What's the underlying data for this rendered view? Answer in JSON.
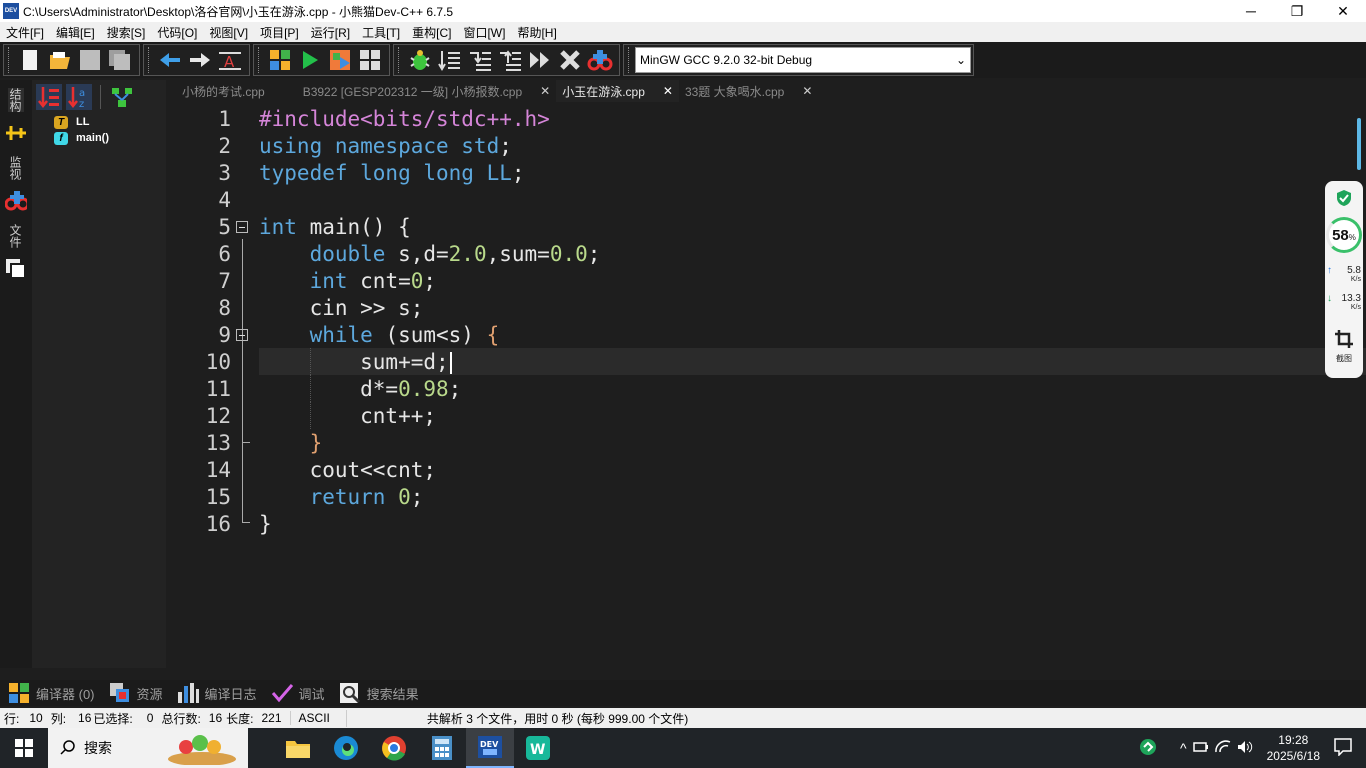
{
  "window": {
    "title": "C:\\Users\\Administrator\\Desktop\\洛谷官网\\小玉在游泳.cpp - 小熊猫Dev-C++ 6.7.5",
    "app_icon": "DEV",
    "controls": {
      "minimize": "─",
      "maximize": "❐",
      "close": "✕"
    }
  },
  "menu": [
    "文件[F]",
    "编辑[E]",
    "搜索[S]",
    "代码[O]",
    "视图[V]",
    "项目[P]",
    "运行[R]",
    "工具[T]",
    "重构[C]",
    "窗口[W]",
    "帮助[H]"
  ],
  "toolbar": {
    "compiler": "MinGW GCC 9.2.0 32-bit Debug",
    "dropdown_arrow": "⌄"
  },
  "left_tabs": {
    "structure": "结构",
    "watch": "监视",
    "files": "文件"
  },
  "class_browser": {
    "items": [
      {
        "badge": "T",
        "label": "LL",
        "badge_color": "#d9a520"
      },
      {
        "badge": "f",
        "label": "main()",
        "badge_color": "#40d8e8"
      }
    ]
  },
  "tabs": [
    {
      "label": "小杨的考试.cpp",
      "active": false
    },
    {
      "label": "B3922 [GESP202312 一级] 小杨报数.cpp",
      "active": false,
      "close": "✕"
    },
    {
      "label": "小玉在游泳.cpp",
      "active": true,
      "close": "✕"
    },
    {
      "label": "33题 大象喝水.cpp",
      "active": false,
      "close": "✕"
    }
  ],
  "code": {
    "line_numbers": [
      "1",
      "2",
      "3",
      "4",
      "5",
      "6",
      "7",
      "8",
      "9",
      "10",
      "11",
      "12",
      "13",
      "14",
      "15",
      "16"
    ],
    "current_line": 10
  },
  "net_widget": {
    "percent": "58",
    "percent_unit": "%",
    "upload": "5.8",
    "upload_unit": "K/s",
    "download": "13.3",
    "download_unit": "K/s",
    "screenshot_label": "截图"
  },
  "bottom_tabs": [
    {
      "label": "编译器 (0)",
      "icon": "compiler-icon"
    },
    {
      "label": "资源",
      "icon": "resources-icon"
    },
    {
      "label": "编译日志",
      "icon": "compile-log-icon"
    },
    {
      "label": "调试",
      "icon": "debug-icon"
    },
    {
      "label": "搜索结果",
      "icon": "search-results-icon"
    }
  ],
  "status": {
    "row_label": "行:",
    "row": "10",
    "col_label": "列:",
    "col": "16",
    "selected_label": "已选择:",
    "selected": "0",
    "total_lines_label": "总行数:",
    "total_lines": "16",
    "length_label": "长度:",
    "length": "221",
    "encoding": "ASCII",
    "message": "共解析 3 个文件，用时 0 秒 (每秒 999.00 个文件)"
  },
  "taskbar": {
    "search_label": "搜索",
    "time": "19:28",
    "date": "2025/6/18"
  }
}
